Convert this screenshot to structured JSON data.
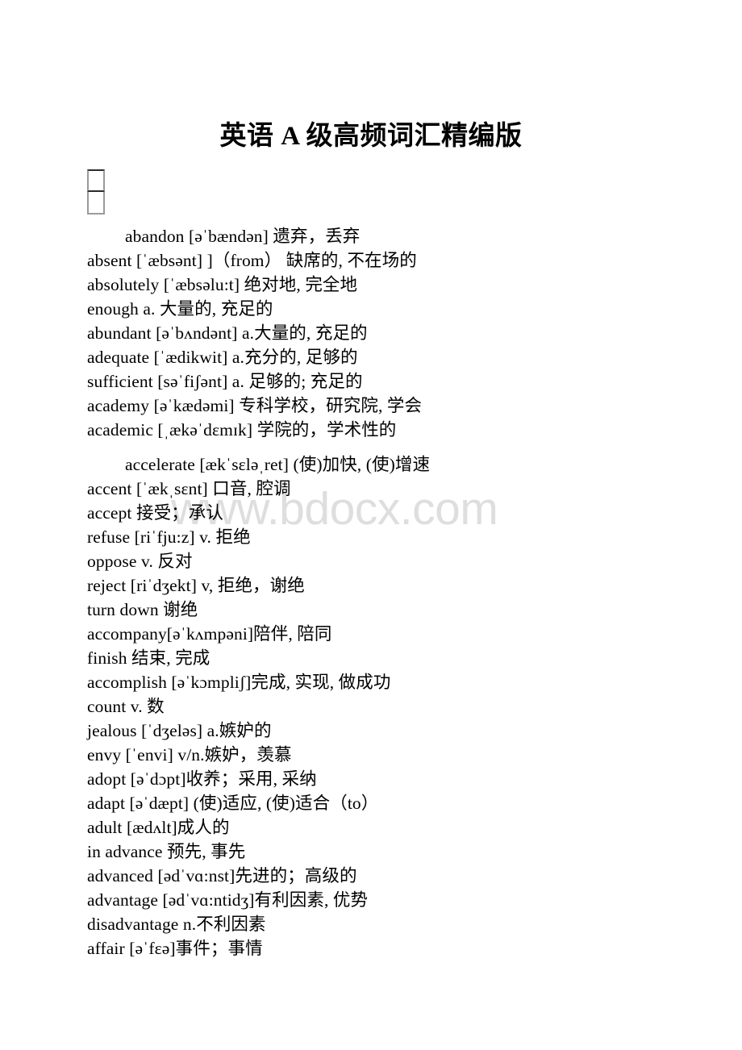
{
  "document": {
    "title": "英语 A 级高频词汇精编版",
    "placeholder_glyph": "missing-glyph-box",
    "watermark": "www.bdocx.com",
    "watermark_color": "#dedede",
    "text_color": "#000000",
    "background_color": "#ffffff"
  },
  "paragraphs": [
    {
      "id": "vocab-block-a1",
      "first_line_indented": true,
      "lines": [
        "abandon [əˈbændən] 遗弃，丢弃",
        "absent [ˈæbsənt] ]（from） 缺席的, 不在场的",
        "absolutely [ˈæbsəlu:t] 绝对地, 完全地",
        "enough a. 大量的, 充足的",
        "abundant [əˈbʌndənt] a.大量的, 充足的",
        "adequate [ˈædikwit] a.充分的, 足够的",
        "sufficient [səˈfiʃənt] a. 足够的; 充足的",
        "academy [əˈkædəmi] 专科学校，研究院, 学会",
        "academic [ˌækəˈdɛmɪk] 学院的，学术性的"
      ]
    },
    {
      "id": "vocab-block-a2",
      "first_line_indented": true,
      "lines": [
        "accelerate [ækˈsɛləˌret] (使)加快, (使)增速",
        "accent [ˈækˌsɛnt] 口音, 腔调",
        "accept 接受；承认",
        "refuse [riˈfju:z] v. 拒绝",
        "oppose v. 反对",
        "reject [riˈdʒekt] v, 拒绝，谢绝",
        "turn down 谢绝",
        "accompany[əˈkʌmpəni]陪伴, 陪同",
        "finish 结束, 完成",
        "accomplish [əˈkɔmpliʃ]完成, 实现, 做成功",
        "count v. 数",
        "jealous [ˈdʒeləs] a.嫉妒的",
        "envy [ˈenvi] v/n.嫉妒，羡慕",
        "adopt [əˈdɔpt]收养；采用, 采纳",
        "adapt [əˈdæpt] (使)适应, (使)适合（to）",
        "adult [ædʌlt]成人的",
        "in advance 预先, 事先",
        "advanced [ədˈvɑ:nst]先进的；高级的",
        "advantage [ədˈvɑ:ntidʒ]有利因素, 优势",
        "disadvantage n.不利因素",
        "affair [əˈfɛə]事件；事情"
      ]
    }
  ]
}
